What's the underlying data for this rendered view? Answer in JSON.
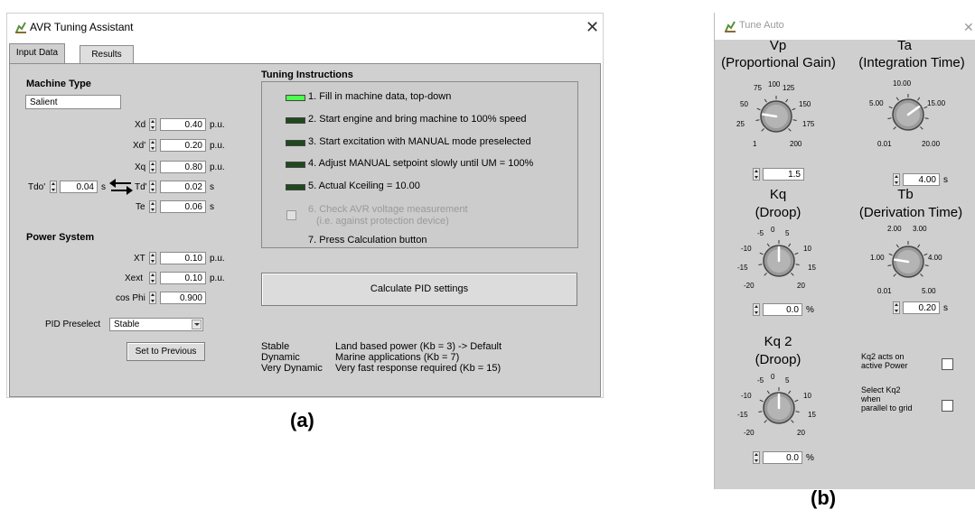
{
  "window_a": {
    "title": "AVR Tuning Assistant",
    "tabs": [
      "Input Data",
      "Results"
    ],
    "machine_type": {
      "heading": "Machine Type",
      "value": "Salient",
      "params": [
        {
          "label": "Xd",
          "value": "0.40",
          "unit": "p.u."
        },
        {
          "label": "Xd'",
          "value": "0.20",
          "unit": "p.u."
        },
        {
          "label": "Xq",
          "value": "0.80",
          "unit": "p.u."
        },
        {
          "label": "Td'",
          "value": "0.02",
          "unit": "s"
        },
        {
          "label": "Te",
          "value": "0.06",
          "unit": "s"
        }
      ],
      "tdo": {
        "label": "Tdo'",
        "value": "0.04",
        "unit": "s"
      }
    },
    "power_system": {
      "heading": "Power System",
      "params": [
        {
          "label": "XT",
          "value": "0.10",
          "unit": "p.u."
        },
        {
          "label": "Xext",
          "value": "0.10",
          "unit": "p.u."
        },
        {
          "label": "cos Phi",
          "value": "0.900",
          "unit": ""
        }
      ]
    },
    "pid_preselect": {
      "label": "PID Preselect",
      "value": "Stable"
    },
    "set_previous_button": "Set to Previous",
    "tuning": {
      "heading": "Tuning Instructions",
      "steps": [
        {
          "text": "1. Fill in machine data, top-down",
          "led": "on"
        },
        {
          "text": "2. Start engine and bring machine to 100% speed",
          "led": "off"
        },
        {
          "text": "3. Start excitation with MANUAL mode preselected",
          "led": "off"
        },
        {
          "text": "4. Adjust MANUAL setpoint slowly until UM = 100%",
          "led": "off"
        },
        {
          "text": "5. Actual Kceiling =   10.00",
          "led": "off"
        },
        {
          "text": "6. Check AVR voltage measurement",
          "led": "checkbox"
        },
        {
          "text": "7. Press Calculation button",
          "led": "none"
        }
      ],
      "step6_sub": "(i.e. against protection device)"
    },
    "calc_button": "Calculate PID settings",
    "modes": [
      {
        "name": "Stable",
        "desc": "Land based power (Kb = 3) -> Default"
      },
      {
        "name": "Dynamic",
        "desc": "Marine applications (Kb = 7)"
      },
      {
        "name": "Very Dynamic",
        "desc": "Very fast response required (Kb = 15)"
      }
    ]
  },
  "window_b": {
    "title": "Tune Auto",
    "knobs": {
      "vp": {
        "title": "Vp",
        "subtitle": "(Proportional Gain)",
        "value": "1.5",
        "unit": "",
        "ticks": [
          "25",
          "50",
          "75",
          "100",
          "125",
          "150",
          "175",
          "200",
          "1"
        ],
        "level": 0.2
      },
      "ta": {
        "title": "Ta",
        "subtitle": "(Integration Time)",
        "value": "4.00",
        "unit": "s",
        "ticks": [
          "5.00",
          "10.00",
          "15.00",
          "20.00",
          "0.01"
        ],
        "level": 0.7
      },
      "kq": {
        "title": "Kq",
        "subtitle": "(Droop)",
        "value": "0.0",
        "unit": "%",
        "ticks": [
          "-5",
          "0",
          "5",
          "-10",
          "10",
          "-15",
          "15",
          "-20",
          "20"
        ],
        "level": 0.5
      },
      "tb": {
        "title": "Tb",
        "subtitle": "(Derivation Time)",
        "value": "0.20",
        "unit": "s",
        "ticks": [
          "2.00",
          "3.00",
          "1.00",
          "4.00",
          "0.01",
          "5.00"
        ],
        "level": 0.2
      },
      "kq2": {
        "title": "Kq 2",
        "subtitle": "(Droop)",
        "value": "0.0",
        "unit": "%",
        "ticks": [
          "-5",
          "0",
          "5",
          "-10",
          "10",
          "-15",
          "15",
          "-20",
          "20"
        ],
        "level": 0.5
      }
    },
    "checks": {
      "kq2_active": {
        "label": "Kq2 acts on active Power",
        "lines": [
          "Kq2 acts on",
          "active Power"
        ]
      },
      "select_kq2": {
        "label": "Select Kq2 when parallel to grid",
        "lines": [
          "Select Kq2",
          "when",
          "parallel to grid"
        ]
      }
    }
  },
  "captions": {
    "a": "(a)",
    "b": "(b)"
  }
}
